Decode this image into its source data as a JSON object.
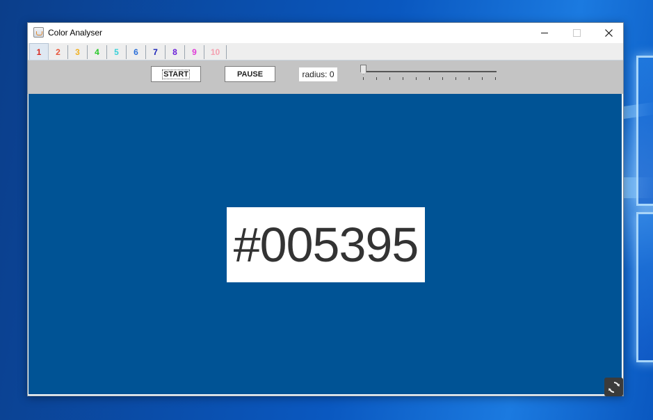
{
  "window": {
    "title": "Color Analyser"
  },
  "tabs": [
    {
      "label": "1",
      "color": "#d8281e",
      "selected": true
    },
    {
      "label": "2",
      "color": "#e8553a"
    },
    {
      "label": "3",
      "color": "#f0b020"
    },
    {
      "label": "4",
      "color": "#28c828"
    },
    {
      "label": "5",
      "color": "#38d0d8"
    },
    {
      "label": "6",
      "color": "#2a6ed8"
    },
    {
      "label": "7",
      "color": "#1a22b8"
    },
    {
      "label": "8",
      "color": "#6a1ed8"
    },
    {
      "label": "9",
      "color": "#e03ad8"
    },
    {
      "label": "10",
      "color": "#f4a0b0"
    }
  ],
  "toolbar": {
    "start_label": "START",
    "pause_label": "PAUSE",
    "radius_label": "radius: 0",
    "radius_value": 0
  },
  "display": {
    "hex": "#005395",
    "background": "#005395"
  }
}
